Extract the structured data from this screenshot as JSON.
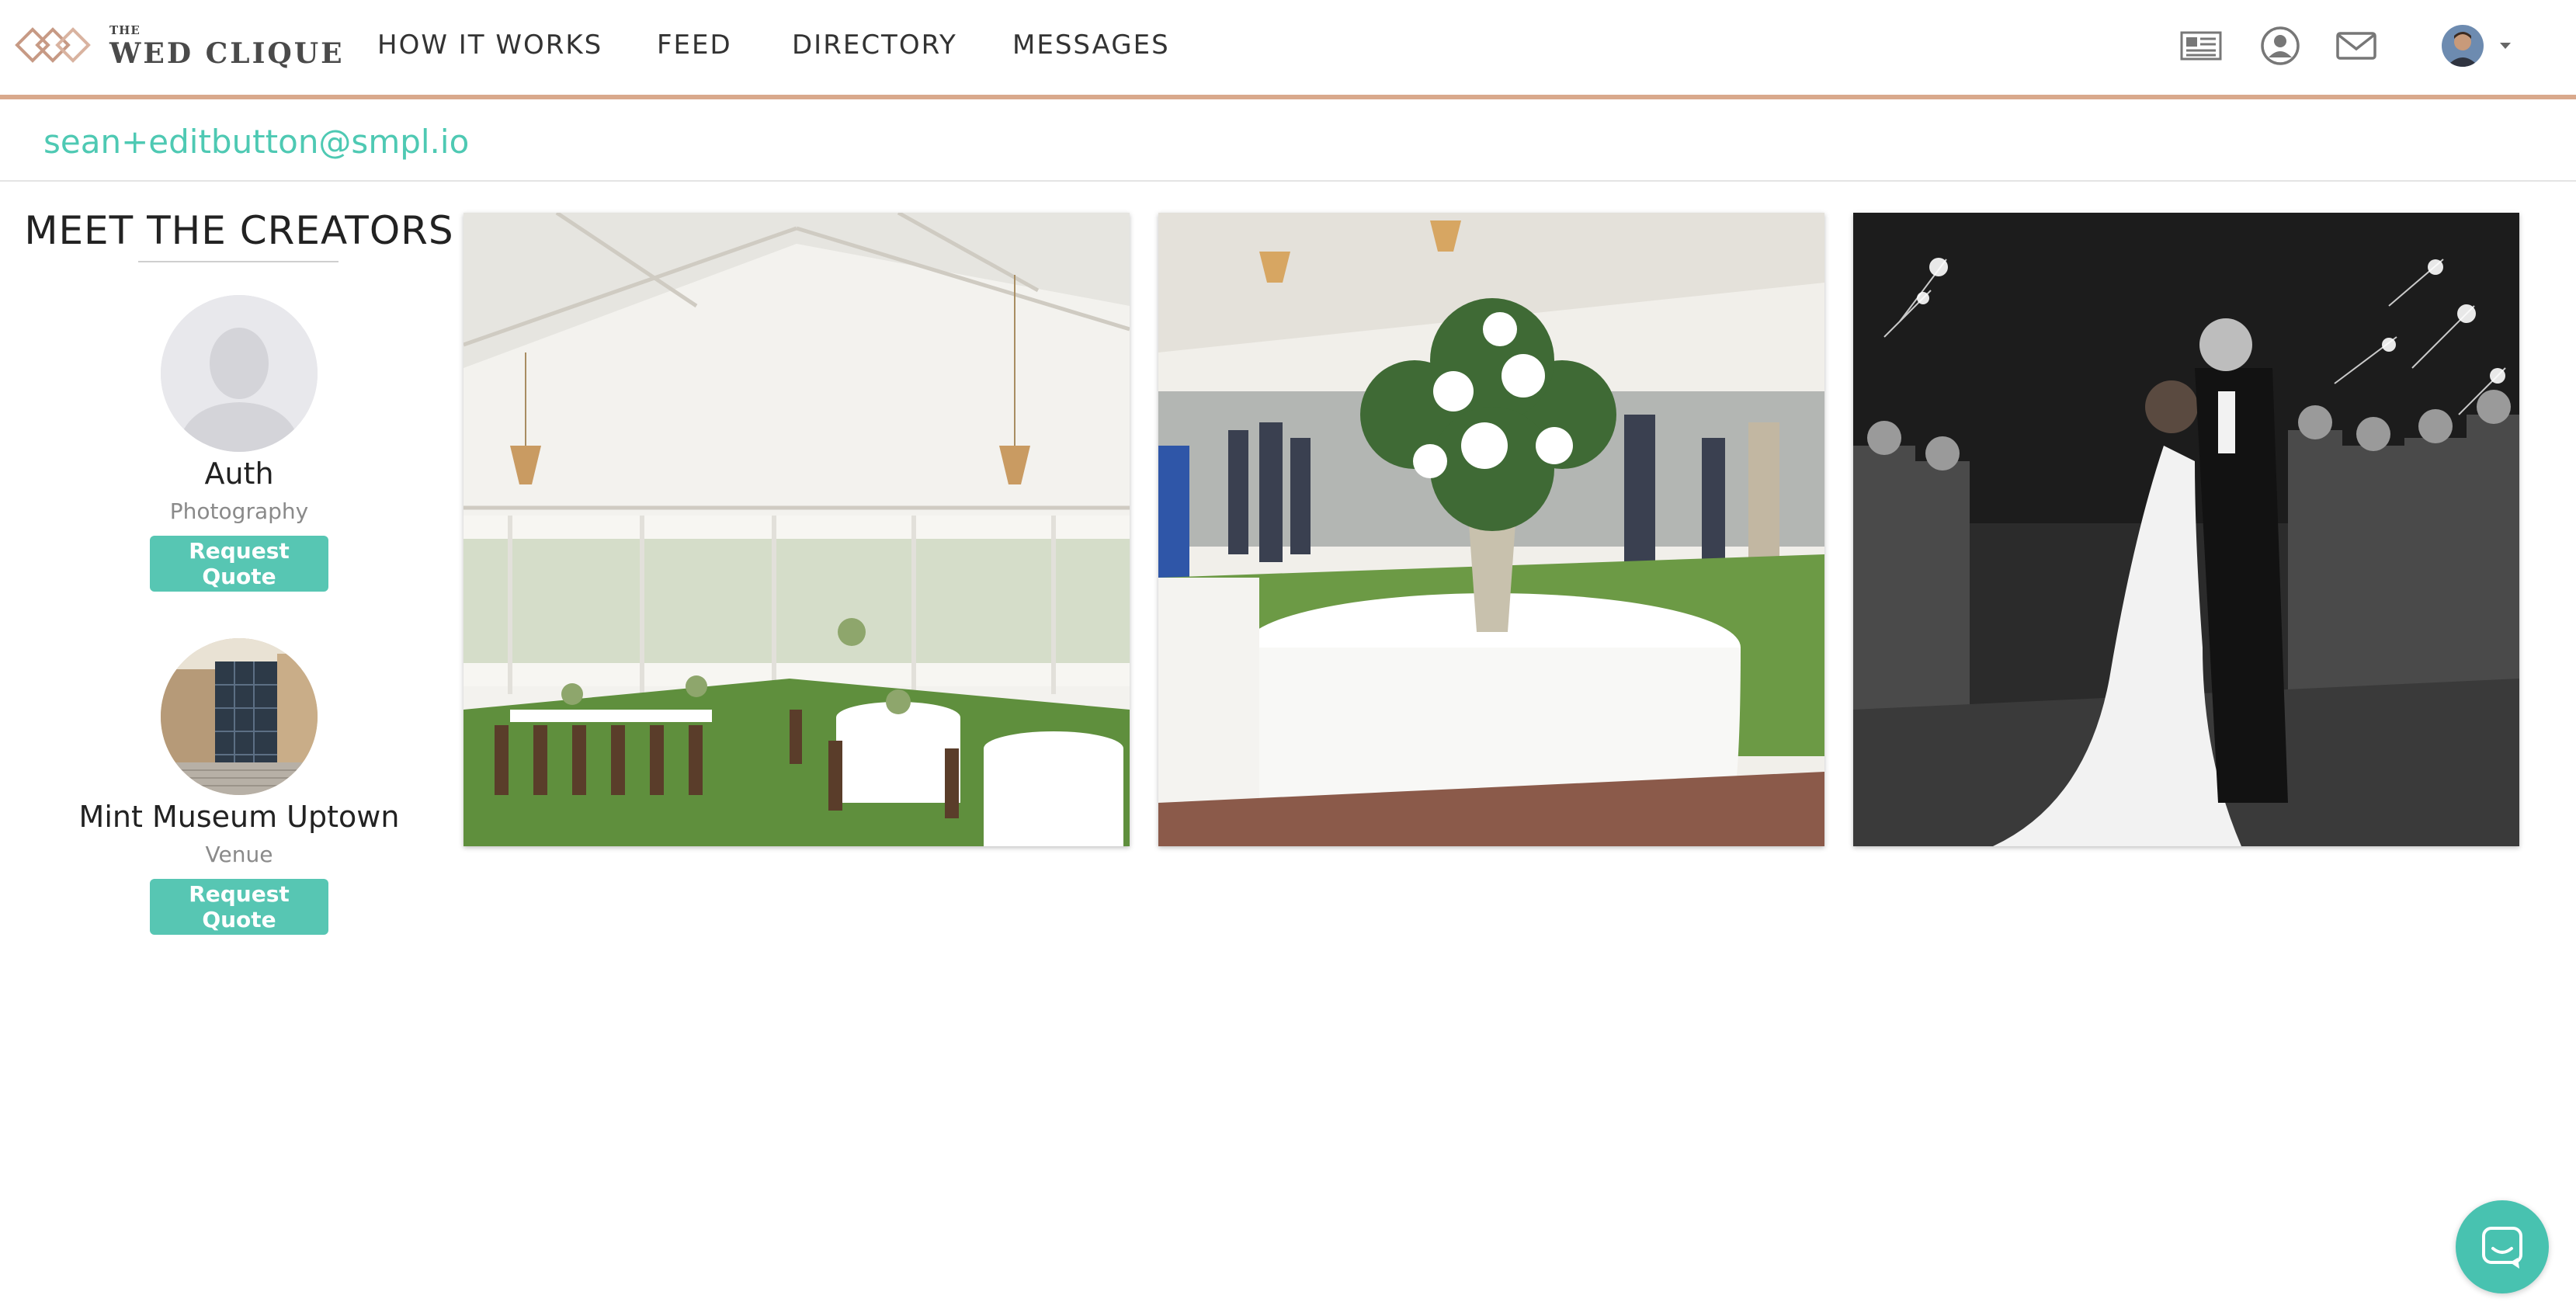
{
  "brand": {
    "logo_small": "THE",
    "logo_name": "WED CLIQUE",
    "accent_color": "#57c6b3",
    "header_rule_color": "#d9a98c"
  },
  "nav": {
    "items": [
      {
        "label": "HOW IT WORKS"
      },
      {
        "label": "FEED"
      },
      {
        "label": "DIRECTORY"
      },
      {
        "label": "MESSAGES"
      }
    ],
    "icons": [
      "newspaper-icon",
      "user-circle-icon",
      "envelope-icon",
      "avatar",
      "caret-down-icon"
    ]
  },
  "user": {
    "email": "sean+editbutton@smpl.io"
  },
  "sidebar": {
    "title": "MEET THE CREATORS",
    "creators": [
      {
        "name": "Auth",
        "category": "Photography",
        "button": "Request Quote"
      },
      {
        "name": "Mint Museum Uptown",
        "category": "Venue",
        "button": "Request Quote"
      }
    ]
  },
  "gallery": {
    "photos": [
      "tent-reception-photo",
      "floral-centerpiece-photo",
      "sparkler-exit-photo"
    ]
  },
  "chat": {
    "icon": "chat-icon"
  }
}
